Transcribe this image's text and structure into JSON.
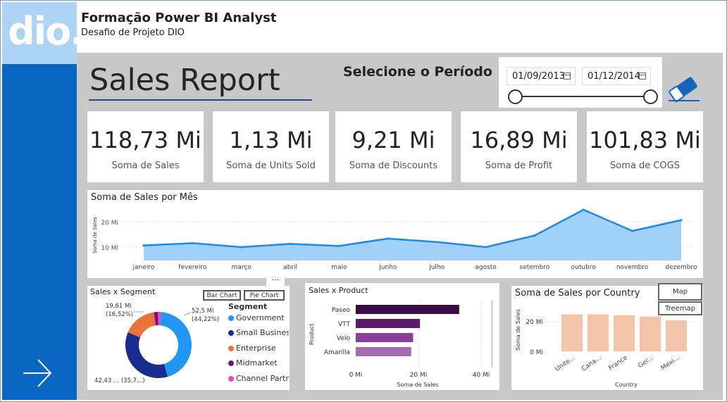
{
  "header": {
    "title": "Formação Power BI Analyst",
    "subtitle": "Desafio de Projeto DIO",
    "logo_text": "dio."
  },
  "report": {
    "title": "Sales Report",
    "period_label": "Selecione o Período",
    "date_start": "01/09/2013",
    "date_end": "01/12/2014"
  },
  "kpis": [
    {
      "value": "118,73 Mi",
      "label": "Soma de  Sales"
    },
    {
      "value": "1,13 Mi",
      "label": "Soma de Units Sold"
    },
    {
      "value": "9,21 Mi",
      "label": "Soma de Discounts"
    },
    {
      "value": "16,89 Mi",
      "label": "Soma de Profit"
    },
    {
      "value": "101,83 Mi",
      "label": "Soma de COGS"
    }
  ],
  "colors": {
    "sidebar": "#0a66c2",
    "logo_bg": "#aed4f5",
    "canvas": "#c8c8c8",
    "line": "#1e88e5",
    "area": "#90c8f8"
  },
  "icons": {
    "eraser": "eraser-icon",
    "next": "arrow-right-icon",
    "more": "more-options-icon",
    "calendar": "calendar-icon"
  },
  "line_chart": {
    "title": "Soma de Sales por Mês",
    "ylabel": "Soma de Sales",
    "yticks": [
      "20 Mi",
      "10 Mi"
    ]
  },
  "segment_chart": {
    "title": "Sales x Segment",
    "bar_chart_button": "Bar Chart",
    "pie_chart_button": "Pie Chart",
    "legend_title": "Segment",
    "label_right": [
      "52,5 Mi",
      "(44,22%)"
    ],
    "label_left": [
      "19,61 Mi",
      "(16,52%)"
    ],
    "label_bottom": "42,43 ... (35,7...)"
  },
  "product_chart": {
    "title": "Sales x Product",
    "ylabel": "Product",
    "xlabel": "Soma de Sales",
    "xticks": [
      "0 Mi",
      "20 Mi",
      "40 Mi"
    ]
  },
  "country_chart": {
    "title": "Soma de Sales por Country",
    "ylabel": "Soma de Sales",
    "xlabel": "Country",
    "yticks": [
      "20 Mi",
      "0 Mi"
    ],
    "map_button": "Map",
    "treemap_button": "Treemap"
  },
  "chart_data": [
    {
      "type": "area",
      "title": "Soma de Sales por Mês",
      "ylabel": "Soma de Sales",
      "categories": [
        "janeiro",
        "fevereiro",
        "março",
        "abril",
        "maio",
        "junho",
        "julho",
        "agosto",
        "setembro",
        "outubro",
        "novembro",
        "dezembro"
      ],
      "values": [
        6.5,
        7.5,
        5.8,
        7.2,
        6.3,
        9.5,
        8.0,
        5.8,
        10.8,
        22.0,
        12.8,
        17.5
      ],
      "ylim": [
        0,
        25
      ],
      "units": "Mi"
    },
    {
      "type": "pie",
      "title": "Sales x Segment",
      "categories": [
        "Government",
        "Small Business",
        "Enterprise",
        "Midmarket",
        "Channel Partners"
      ],
      "values": [
        52.5,
        42.43,
        19.61,
        2.38,
        1.8
      ],
      "colors": [
        "#2196f3",
        "#1a2d8f",
        "#e8743b",
        "#7a0f8c",
        "#e84ab8"
      ]
    },
    {
      "type": "bar",
      "title": "Sales x Product",
      "categories": [
        "Paseo",
        "VTT",
        "Velo",
        "Amarilla"
      ],
      "values": [
        33.0,
        20.5,
        18.3,
        17.7
      ],
      "xlim": [
        0,
        45
      ],
      "colors": [
        "#3a0c45",
        "#5c1a6b",
        "#8a3f9c",
        "#a56bb0"
      ]
    },
    {
      "type": "bar",
      "title": "Soma de Sales por Country",
      "categories": [
        "Unite...",
        "Cana...",
        "France",
        "Ger...",
        "Mexi..."
      ],
      "values": [
        25.0,
        25.0,
        24.4,
        23.5,
        21.0
      ],
      "ylim": [
        0,
        30
      ],
      "color": "#f4c4aa"
    }
  ]
}
